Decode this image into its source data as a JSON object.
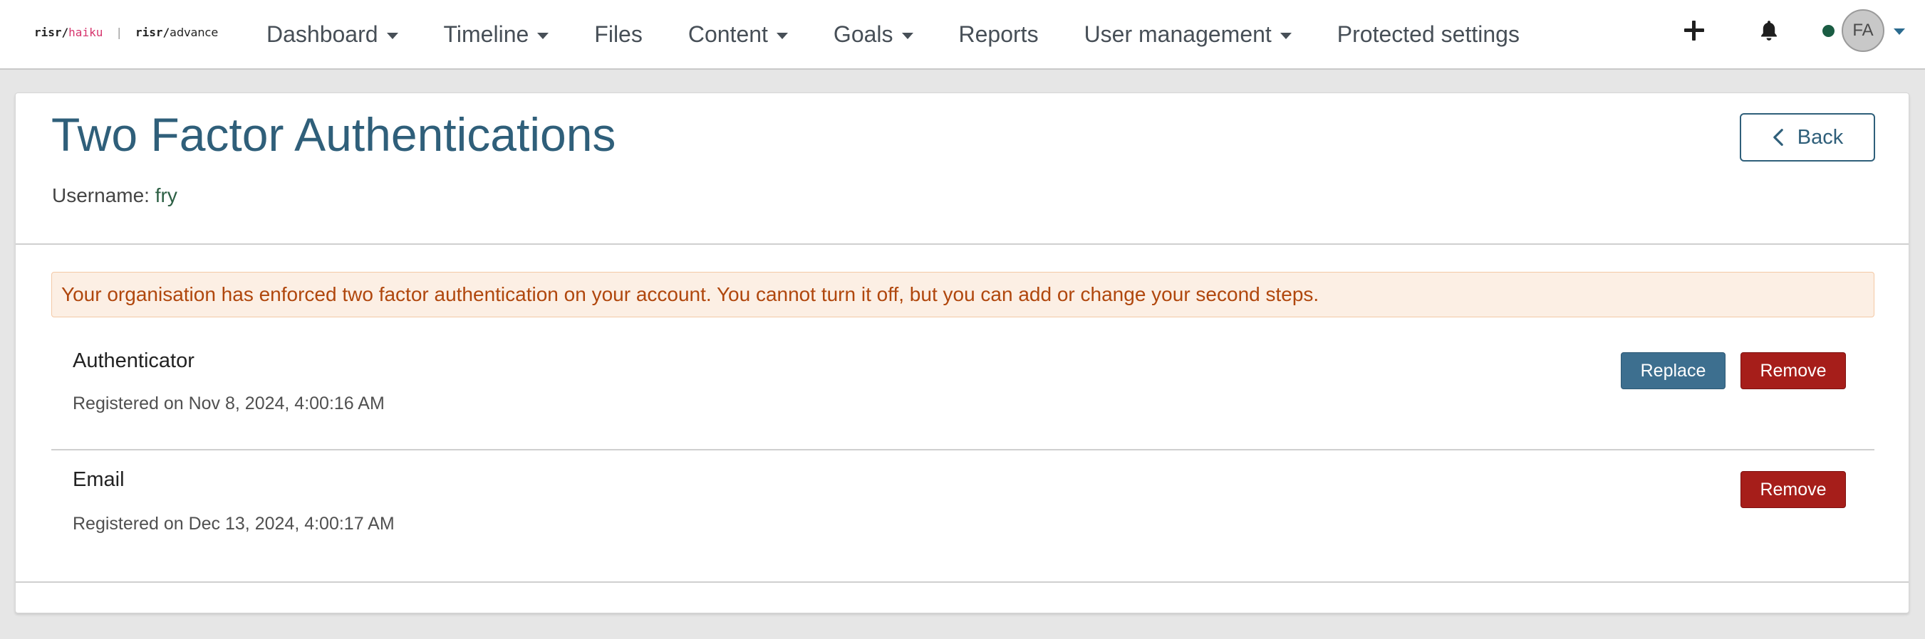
{
  "logo": {
    "brand1": "risr/",
    "brand1_accent": "haiku",
    "separator": "|",
    "brand2": "risr/",
    "brand2_suffix": "advance"
  },
  "nav": {
    "items": [
      {
        "label": "Dashboard",
        "has_dropdown": true
      },
      {
        "label": "Timeline",
        "has_dropdown": true
      },
      {
        "label": "Files",
        "has_dropdown": false
      },
      {
        "label": "Content",
        "has_dropdown": true
      },
      {
        "label": "Goals",
        "has_dropdown": true
      },
      {
        "label": "Reports",
        "has_dropdown": false
      },
      {
        "label": "User management",
        "has_dropdown": true
      },
      {
        "label": "Protected settings",
        "has_dropdown": false
      }
    ]
  },
  "tools": {
    "add_icon": "plus-icon",
    "notifications_icon": "bell-icon",
    "avatar_initials": "FA",
    "status_color": "#1a5c43"
  },
  "page": {
    "title": "Two Factor Authentications",
    "username_label": "Username: ",
    "username_value": "fry",
    "back_label": "Back"
  },
  "alert": {
    "text": "Your organisation has enforced two factor authentication on your account. You cannot turn it off, but you can add or change your second steps."
  },
  "methods": [
    {
      "name": "Authenticator",
      "registered": "Registered on Nov 8, 2024, 4:00:16 AM",
      "replace_label": "Replace",
      "remove_label": "Remove"
    },
    {
      "name": "Email",
      "registered": "Registered on Dec 13, 2024, 4:00:17 AM",
      "remove_label": "Remove"
    }
  ],
  "colors": {
    "title": "#2f5f7a",
    "replace_button": "#3d6f8f",
    "remove_button": "#a61e1a",
    "alert_bg": "#fcefe4",
    "alert_text": "#b0470d"
  }
}
